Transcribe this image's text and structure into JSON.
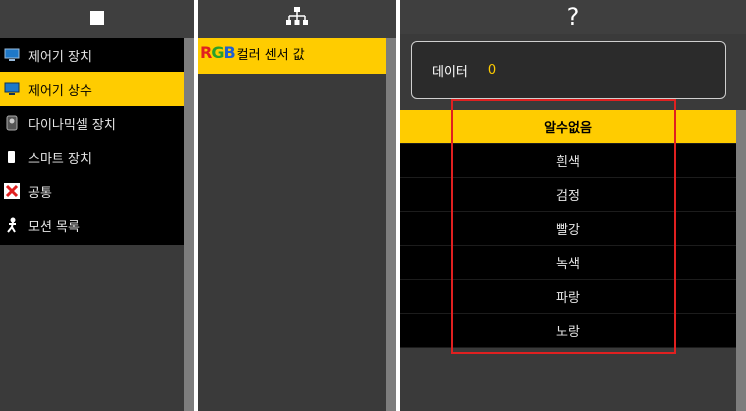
{
  "panel1": {
    "header_icon": "stop-square-icon",
    "items": [
      {
        "label": "제어기 장치",
        "icon": "monitor-icon",
        "selected": false
      },
      {
        "label": "제어기 상수",
        "icon": "monitor-icon",
        "selected": true
      },
      {
        "label": "다이나믹셀 장치",
        "icon": "servo-icon",
        "selected": false
      },
      {
        "label": "스마트 장치",
        "icon": "smart-device-icon",
        "selected": false
      },
      {
        "label": "공통",
        "icon": "common-x-icon",
        "selected": false
      },
      {
        "label": "모션 목록",
        "icon": "motion-icon",
        "selected": false
      }
    ]
  },
  "panel2": {
    "header_icon": "hierarchy-icon",
    "items": [
      {
        "badge_r": "R",
        "badge_g": "G",
        "badge_b": "B",
        "label": "컬러 센서 값",
        "selected": true
      }
    ]
  },
  "panel3": {
    "header_icon": "question-icon",
    "header_glyph": "?",
    "data": {
      "label": "데이터",
      "value": "0"
    },
    "options": [
      "알수없음",
      "흰색",
      "검정",
      "빨강",
      "녹색",
      "파랑",
      "노랑"
    ],
    "selected_index": 0
  },
  "colors": {
    "accent": "#ffcc00",
    "highlight": "#e02020",
    "panel": "#3a3a3a",
    "list_bg": "#000000"
  }
}
